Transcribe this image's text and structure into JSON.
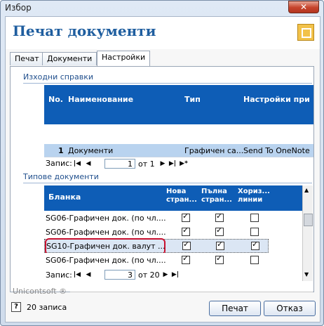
{
  "window": {
    "title": "Избор",
    "close_glyph": "✕"
  },
  "header": {
    "title": "Печат документи",
    "icon": "print-frame-icon"
  },
  "tabs": [
    {
      "label": "Печат"
    },
    {
      "label": "Документи"
    },
    {
      "label": "Настройки"
    }
  ],
  "source": {
    "title": "Изходни справки",
    "columns": {
      "no": "No.",
      "name": "Наименование",
      "type": "Тип",
      "printer": "Настройки при"
    },
    "row": {
      "no": "1",
      "name": "Документи",
      "type": "Графичен са...",
      "printer": "Send To OneNote"
    },
    "nav": {
      "label": "Запис:",
      "value": "1",
      "of": "от 1"
    }
  },
  "types": {
    "title": "Типове документи",
    "columns": {
      "form": "Бланка",
      "new_page": "Нова стран...",
      "full_page": "Пълна стран...",
      "hlines": "Хориз... линии"
    },
    "rows": [
      {
        "form": "SG06-Графичен док. (по чл....",
        "new": true,
        "full": true,
        "h": false
      },
      {
        "form": "SG06-Графичен док. (по чл....",
        "new": true,
        "full": true,
        "h": false
      },
      {
        "form": "SG10-Графичен док. валут ...",
        "new": true,
        "full": true,
        "h": true
      },
      {
        "form": "SG06-Графичен док. (по чл....",
        "new": true,
        "full": true,
        "h": false
      }
    ],
    "nav": {
      "label": "Запис:",
      "value": "3",
      "of": "от 20"
    }
  },
  "footer": {
    "brand": "Unicontsoft ®",
    "count": "20 записа",
    "print_label": "Печат",
    "cancel_label": "Отказ"
  }
}
